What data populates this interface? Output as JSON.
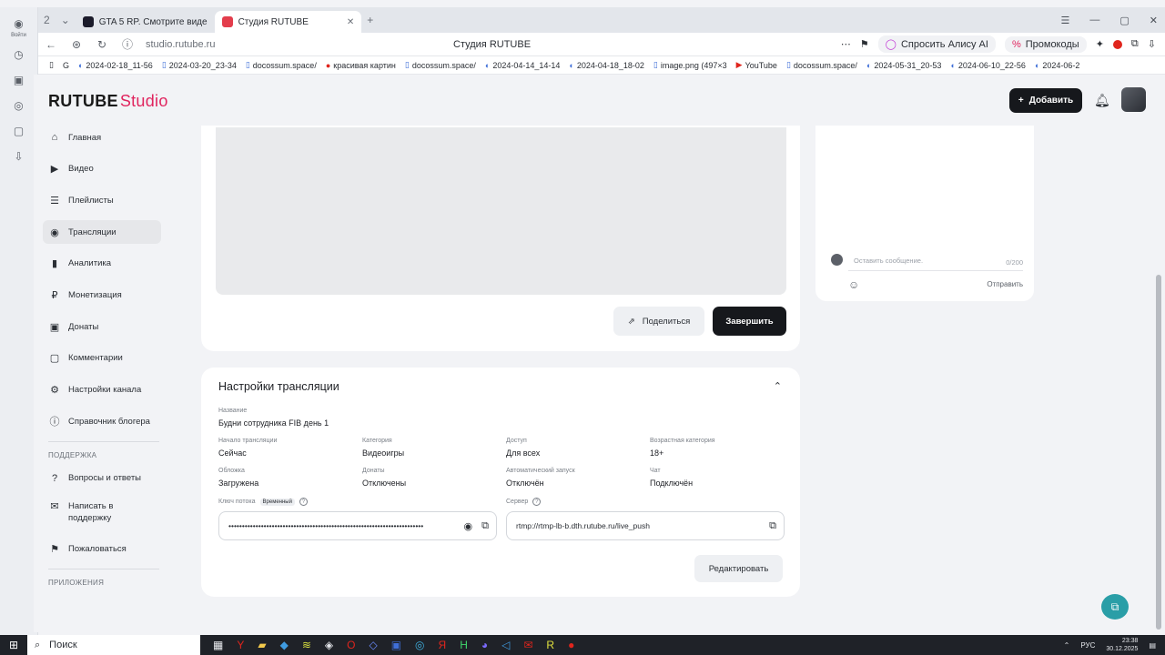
{
  "browser": {
    "tabs": [
      {
        "title": "GTA 5 RP. Смотрите виде",
        "active": false
      },
      {
        "title": "Студия RUTUBE",
        "active": true
      }
    ],
    "tab_count_badge": "2",
    "url": "studio.rutube.ru",
    "page_title": "Студия RUTUBE",
    "alice_label": "Спросить Алису AI",
    "promo_label": "Промокоды",
    "left_badge": "Войти",
    "bookmarks": [
      "2024-02-18_11-56",
      "2024-03-20_23-34",
      "docossum.space/",
      "красивая картин",
      "docossum.space/",
      "2024-04-14_14-14",
      "2024-04-18_18-02",
      "image.png (497×3",
      "YouTube",
      "docossum.space/",
      "2024-05-31_20-53",
      "2024-06-10_22-56",
      "2024-06-2"
    ]
  },
  "header": {
    "logo_main": "RUTUBE",
    "logo_studio": "Studio",
    "add_label": "Добавить"
  },
  "sidebar": {
    "items": [
      {
        "label": "Главная",
        "icon": "home-icon",
        "glyph": "⌂"
      },
      {
        "label": "Видео",
        "icon": "video-icon",
        "glyph": "▶"
      },
      {
        "label": "Плейлисты",
        "icon": "playlist-icon",
        "glyph": "☰"
      },
      {
        "label": "Трансляции",
        "icon": "broadcast-icon",
        "glyph": "◉"
      },
      {
        "label": "Аналитика",
        "icon": "analytics-icon",
        "glyph": "▮"
      },
      {
        "label": "Монетизация",
        "icon": "monetization-icon",
        "glyph": "₽"
      },
      {
        "label": "Донаты",
        "icon": "donate-icon",
        "glyph": "▣"
      },
      {
        "label": "Комментарии",
        "icon": "comments-icon",
        "glyph": "▢"
      },
      {
        "label": "Настройки канала",
        "icon": "gear-icon",
        "glyph": "⚙"
      },
      {
        "label": "Справочник блогера",
        "icon": "info-icon",
        "glyph": "ⓘ"
      }
    ],
    "support_heading": "ПОДДЕРЖКА",
    "support_items": [
      {
        "label": "Вопросы и ответы",
        "icon": "question-icon",
        "glyph": "?"
      },
      {
        "label": "Написать в поддержку",
        "icon": "mail-icon",
        "glyph": "✉"
      },
      {
        "label": "Пожаловаться",
        "icon": "flag-icon",
        "glyph": "⚑"
      }
    ],
    "apps_heading": "ПРИЛОЖЕНИЯ"
  },
  "video_card": {
    "share_label": "Поделиться",
    "end_label": "Завершить"
  },
  "chat": {
    "placeholder": "Оставить сообщение.",
    "counter": "0/200",
    "send_label": "Отправить"
  },
  "settings": {
    "title": "Настройки трансляции",
    "name_label": "Название",
    "name_value": "Будни сотрудника FIB день 1",
    "fields": [
      {
        "label": "Начало трансляции",
        "value": "Сейчас"
      },
      {
        "label": "Категория",
        "value": "Видеоигры"
      },
      {
        "label": "Доступ",
        "value": "Для всех"
      },
      {
        "label": "Возрастная категория",
        "value": "18+"
      },
      {
        "label": "Обложка",
        "value": "Загружена"
      },
      {
        "label": "Донаты",
        "value": "Отключены"
      },
      {
        "label": "Автоматический запуск",
        "value": "Отключён"
      },
      {
        "label": "Чат",
        "value": "Подключён"
      }
    ],
    "stream_key_label": "Ключ потока",
    "stream_key_badge": "Временный",
    "stream_key_value": "••••••••••••••••••••••••••••••••••••••••••••••••••••••••••••••••••••••••",
    "server_label": "Сервер",
    "server_value": "rtmp://rtmp-lb-b.dth.rutube.ru/live_push",
    "edit_label": "Редактировать"
  },
  "taskbar": {
    "search_label": "Поиск",
    "lang": "РУС",
    "time": "23:38",
    "date": "30.12.2025"
  }
}
